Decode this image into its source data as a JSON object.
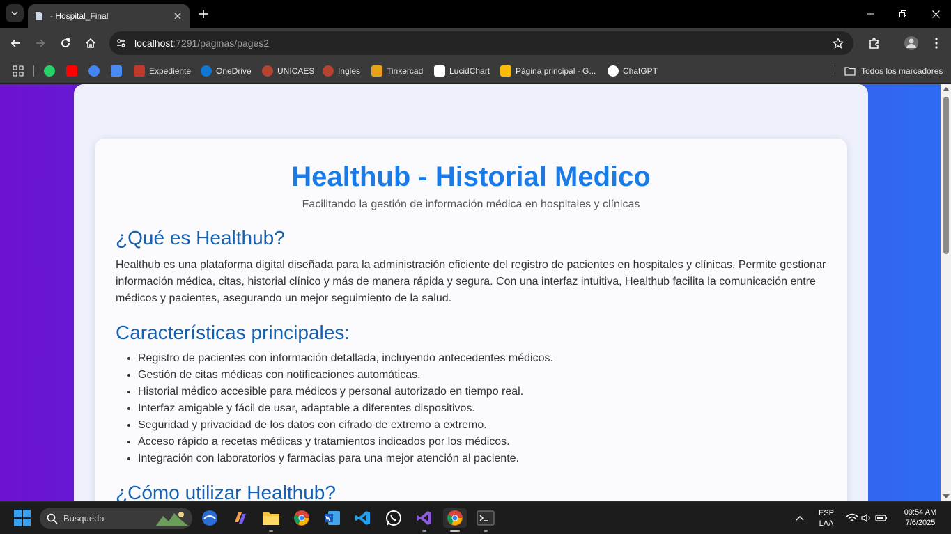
{
  "browser": {
    "tab_title": "- Hospital_Final",
    "url_host": "localhost",
    "url_path": ":7291/paginas/pages2",
    "bookmarks": [
      {
        "label": "",
        "icon": "whatsapp-icon",
        "color": "#25d366"
      },
      {
        "label": "",
        "icon": "youtube-icon",
        "color": "#ff0000"
      },
      {
        "label": "",
        "icon": "google-icon",
        "color": "#4285f4"
      },
      {
        "label": "",
        "icon": "translate-icon",
        "color": "#4a8af4"
      },
      {
        "label": "Expediente",
        "icon": "expediente-icon",
        "color": "#c0392b"
      },
      {
        "label": "OneDrive",
        "icon": "onedrive-icon",
        "color": "#0f78d4"
      },
      {
        "label": "UNICAES",
        "icon": "unicaes-icon",
        "color": "#b5432f"
      },
      {
        "label": "Ingles",
        "icon": "ingles-icon",
        "color": "#b5432f"
      },
      {
        "label": "Tinkercad",
        "icon": "tinkercad-icon",
        "color": "#e8a318"
      },
      {
        "label": "LucidChart",
        "icon": "lucidchart-icon",
        "color": "#ffffff"
      },
      {
        "label": "Página principal - G...",
        "icon": "drive-icon",
        "color": "#fbbc04"
      },
      {
        "label": "ChatGPT",
        "icon": "chatgpt-icon",
        "color": "#ffffff"
      }
    ],
    "all_bookmarks_label": "Todos los marcadores"
  },
  "page": {
    "title": "Healthub - Historial Medico",
    "subtitle": "Facilitando la gestión de información médica en hospitales y clínicas",
    "section1_heading": "¿Qué es Healthub?",
    "section1_text": "Healthub es una plataforma digital diseñada para la administración eficiente del registro de pacientes en hospitales y clínicas. Permite gestionar información médica, citas, historial clínico y más de manera rápida y segura. Con una interfaz intuitiva, Healthub facilita la comunicación entre médicos y pacientes, asegurando un mejor seguimiento de la salud.",
    "section2_heading": "Características principales:",
    "features": [
      "Registro de pacientes con información detallada, incluyendo antecedentes médicos.",
      "Gestión de citas médicas con notificaciones automáticas.",
      "Historial médico accesible para médicos y personal autorizado en tiempo real.",
      "Interfaz amigable y fácil de usar, adaptable a diferentes dispositivos.",
      "Seguridad y privacidad de los datos con cifrado de extremo a extremo.",
      "Acceso rápido a recetas médicas y tratamientos indicados por los médicos.",
      "Integración con laboratorios y farmacias para una mejor atención al paciente."
    ],
    "section3_heading": "¿Cómo utilizar Healthub?"
  },
  "taskbar": {
    "search_label": "Búsqueda",
    "lang_line1": "ESP",
    "lang_line2": "LAA",
    "time": "09:54 AM",
    "date": "7/6/2025"
  },
  "colors": {
    "title_blue": "#1a7be6",
    "heading_blue": "#1560b0",
    "bg_purple": "#6c12d0",
    "bg_blue": "#2d6df5"
  }
}
